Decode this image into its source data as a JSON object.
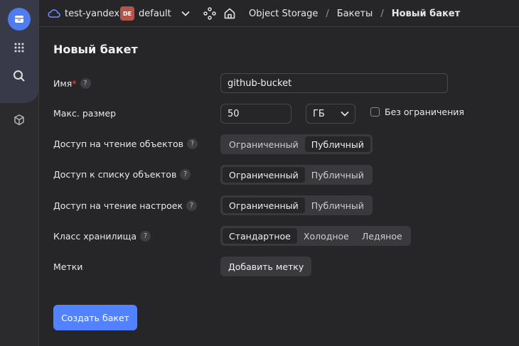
{
  "header": {
    "cloud_name": "test-yandex",
    "folder_badge": "DE",
    "folder_name": "default",
    "breadcrumbs": [
      {
        "label": "Object Storage"
      },
      {
        "label": "Бакеты"
      },
      {
        "label": "Новый бакет"
      }
    ],
    "separator": "/"
  },
  "form": {
    "title": "Новый бакет",
    "name": {
      "label": "Имя",
      "required_mark": "*",
      "value": "github-bucket"
    },
    "max_size": {
      "label": "Макс. размер",
      "value": "50",
      "unit": "ГБ",
      "unlimited_label": "Без ограничения",
      "unlimited_checked": false
    },
    "read_objects": {
      "label": "Доступ на чтение объектов",
      "options": [
        "Ограниченный",
        "Публичный"
      ],
      "selected": "Публичный"
    },
    "list_objects": {
      "label": "Доступ к списку объектов",
      "options": [
        "Ограниченный",
        "Публичный"
      ],
      "selected": "Ограниченный"
    },
    "read_settings": {
      "label": "Доступ на чтение настроек",
      "options": [
        "Ограниченный",
        "Публичный"
      ],
      "selected": "Ограниченный"
    },
    "storage_class": {
      "label": "Класс хранилища",
      "options": [
        "Стандартное",
        "Холодное",
        "Ледяное"
      ],
      "selected": "Стандартное"
    },
    "tags": {
      "label": "Метки",
      "add_label": "Добавить метку"
    },
    "help_glyph": "?",
    "submit_label": "Создать бакет"
  },
  "icons": {
    "rail": [
      "bucket-icon",
      "apps-grid-icon",
      "search-icon",
      "cube-icon"
    ],
    "header": [
      "cloud-icon",
      "chevron-down-icon",
      "services-icon",
      "home-icon"
    ]
  },
  "colors": {
    "accent": "#5282ff",
    "background": "#262629",
    "required": "#e64f4f",
    "folder_badge": "#b5554a"
  }
}
